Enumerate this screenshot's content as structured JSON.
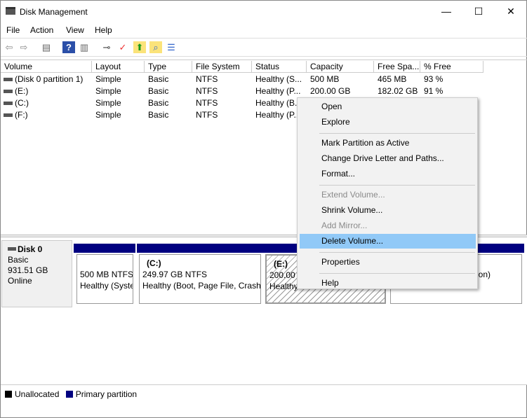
{
  "window": {
    "title": "Disk Management",
    "minimize": "—",
    "maximize": "☐",
    "close": "✕"
  },
  "menu": [
    "File",
    "Action",
    "View",
    "Help"
  ],
  "toolbar": [
    {
      "icon": "back-icon",
      "g": "⇦"
    },
    {
      "icon": "forward-icon",
      "g": "⇨"
    },
    {
      "icon": "show-hide-console-tree-icon",
      "g": "▤"
    },
    {
      "icon": "help-icon",
      "g": "?"
    },
    {
      "icon": "show-action-pane-icon",
      "g": "▥"
    },
    {
      "icon": "connect-drive-icon",
      "g": "⊸"
    },
    {
      "icon": "checklist-icon",
      "g": "✓"
    },
    {
      "icon": "import-folder-icon",
      "g": "⬆"
    },
    {
      "icon": "search-folder-icon",
      "g": "⌕"
    },
    {
      "icon": "properties-list-icon",
      "g": "☰"
    }
  ],
  "columns": [
    "Volume",
    "Layout",
    "Type",
    "File System",
    "Status",
    "Capacity",
    "Free Spa...",
    "% Free"
  ],
  "rows": [
    [
      "(Disk 0 partition 1)",
      "Simple",
      "Basic",
      "NTFS",
      "Healthy (S...",
      "500 MB",
      "465 MB",
      "93 %"
    ],
    [
      "(E:)",
      "Simple",
      "Basic",
      "NTFS",
      "Healthy (P...",
      "200.00 GB",
      "182.02 GB",
      "91 %"
    ],
    [
      "(C:)",
      "Simple",
      "Basic",
      "NTFS",
      "Healthy (B...",
      "",
      "",
      ""
    ],
    [
      "(F:)",
      "Simple",
      "Basic",
      "NTFS",
      "Healthy (P...",
      "",
      "",
      ""
    ]
  ],
  "disk": {
    "name": "Disk 0",
    "type": "Basic",
    "size": "931.51 GB",
    "status": "Online"
  },
  "partitions": [
    {
      "label": "",
      "size": "500 MB NTFS",
      "status": "Healthy (Syste"
    },
    {
      "label": "(C:)",
      "size": "249.97 GB NTFS",
      "status": "Healthy (Boot, Page File, Crash"
    },
    {
      "label": "(E:)",
      "size": "200.00 G",
      "status": "Healthy"
    },
    {
      "label": "",
      "size": "",
      "status": "tion)"
    }
  ],
  "legend": {
    "unallocated": "Unallocated",
    "primary": "Primary partition",
    "colors": {
      "unallocated": "#000000",
      "primary": "#000080"
    }
  },
  "context_menu": {
    "items": [
      {
        "label": "Open"
      },
      {
        "label": "Explore"
      },
      {
        "sep": true
      },
      {
        "label": "Mark Partition as Active"
      },
      {
        "label": "Change Drive Letter and Paths..."
      },
      {
        "label": "Format..."
      },
      {
        "sep": true
      },
      {
        "label": "Extend Volume...",
        "disabled": true
      },
      {
        "label": "Shrink Volume..."
      },
      {
        "label": "Add Mirror...",
        "disabled": true
      },
      {
        "label": "Delete Volume...",
        "highlighted": true
      },
      {
        "sep": true
      },
      {
        "label": "Properties"
      },
      {
        "sep": true
      },
      {
        "label": "Help"
      }
    ]
  }
}
